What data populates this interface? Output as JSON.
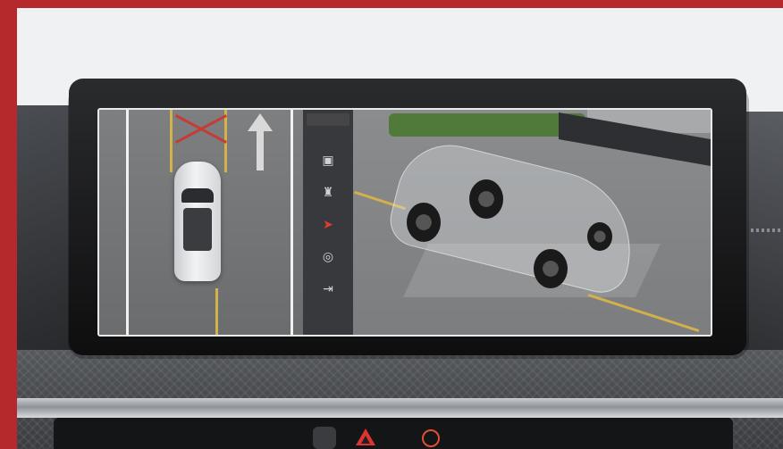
{
  "colors": {
    "frame_red": "#b5282c",
    "active_icon": "#e33b2e",
    "hazard": "#dd3333",
    "lane_yellow": "#d4b24a"
  },
  "screen": {
    "left_panel": {
      "icons": [
        {
          "name": "camera-icon",
          "glyph": "▣",
          "active": false
        },
        {
          "name": "vehicle-view-icon",
          "glyph": "♜",
          "active": false
        },
        {
          "name": "car-3d-icon",
          "glyph": "➤",
          "active": true
        },
        {
          "name": "settings-icon",
          "glyph": "◎",
          "active": false
        },
        {
          "name": "exit-icon",
          "glyph": "⇥",
          "active": false
        }
      ]
    }
  }
}
